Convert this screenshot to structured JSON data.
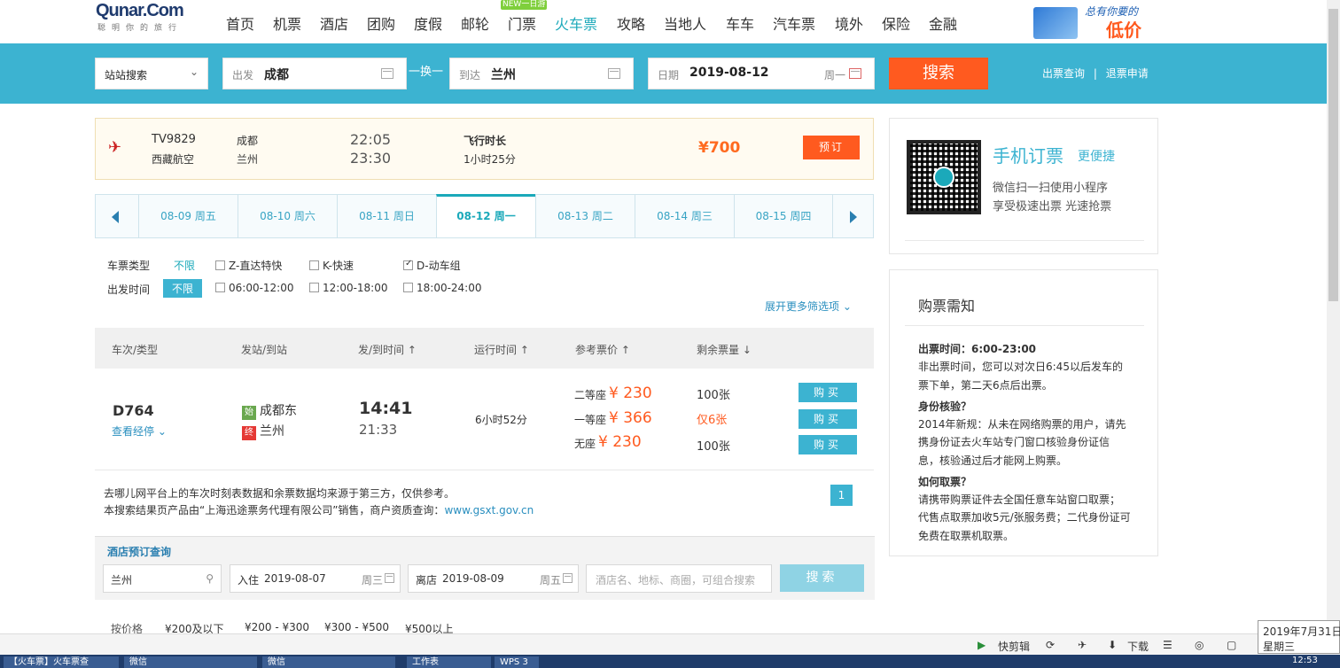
{
  "header": {
    "brand": "Qunar.Com",
    "slogan": "聪明你的旅行",
    "nav": [
      "首页",
      "机票",
      "酒店",
      "团购",
      "度假",
      "邮轮",
      "门票",
      "火车票",
      "攻略",
      "当地人",
      "车车",
      "汽车票",
      "境外",
      "保险",
      "金融"
    ],
    "new_badge": "NEW一日游",
    "promo_line1": "总有你要的",
    "promo_line2": "低价"
  },
  "search": {
    "mode": "站站搜索",
    "from_label": "出发",
    "from_value": "成都",
    "swap_label": "一换一",
    "to_label": "到达",
    "to_value": "兰州",
    "date_label": "日期",
    "date_value": "2019-08-12",
    "weekday": "周一",
    "button": "搜索",
    "link_query": "出票查询",
    "link_refund": "退票申请"
  },
  "flight": {
    "number": "TV9829",
    "airline": "西藏航空",
    "from": "成都",
    "to": "兰州",
    "dep": "22:05",
    "arr": "23:30",
    "dur_label": "飞行时长",
    "dur": "1小时25分",
    "price": "¥700",
    "book": "预订"
  },
  "dates": [
    "08-09 周五",
    "08-10 周六",
    "08-11 周日",
    "08-12 周一",
    "08-13 周二",
    "08-14 周三",
    "08-15 周四"
  ],
  "filters": {
    "type_label": "车票类型",
    "time_label": "出发时间",
    "unlimited": "不限",
    "types": [
      "Z-直达特快",
      "K-快速",
      "D-动车组"
    ],
    "times": [
      "06:00-12:00",
      "12:00-18:00",
      "18:00-24:00"
    ],
    "expand": "展开更多筛选项"
  },
  "results_header": [
    "车次/类型",
    "发站/到站",
    "发/到时间",
    "运行时间",
    "参考票价",
    "剩余票量"
  ],
  "train": {
    "code": "D764",
    "stops_link": "查看经停",
    "start_tag": "始",
    "end_tag": "终",
    "from_station": "成都东",
    "to_station": "兰州",
    "dep": "14:41",
    "arr": "21:33",
    "duration": "6小时52分",
    "seats": [
      {
        "name": "二等座",
        "price": "¥ 230",
        "left": "100张",
        "buy": "购买"
      },
      {
        "name": "一等座",
        "price": "¥ 366",
        "left": "仅6张",
        "buy": "购买"
      },
      {
        "name": "无座",
        "price": "¥ 230",
        "left": "100张",
        "buy": "购买"
      }
    ]
  },
  "notes": {
    "line1": "去哪儿网平台上的车次时刻表数据和余票数据均来源于第三方，仅供参考。",
    "line2": "本搜索结果页产品由“上海迅途票务代理有限公司”销售，商户资质查询：",
    "link": "www.gsxt.gov.cn",
    "page": "1"
  },
  "hotel": {
    "title": "酒店预订查询",
    "city": "兰州",
    "checkin_label": "入住",
    "checkin": "2019-08-07",
    "checkin_wd": "周三",
    "checkout_label": "离店",
    "checkout": "2019-08-09",
    "checkout_wd": "周五",
    "placeholder": "酒店名、地标、商圈，可组合搜索",
    "button": "搜索",
    "price_label": "按价格",
    "prices": [
      "¥200及以下",
      "¥200 - ¥300",
      "¥300 - ¥500",
      "¥500以上"
    ]
  },
  "mobile": {
    "title": "手机订票",
    "title2": "更便捷",
    "line1": "微信扫一扫使用小程序",
    "line2": "享受极速出票 光速抢票"
  },
  "notice": {
    "title": "购票需知",
    "lines": [
      {
        "t": "出票时间：6:00-23:00",
        "b": true
      },
      {
        "t": "非出票时间，您可以对次日6:45以后发车的",
        "b": false
      },
      {
        "t": "票下单，第二天6点后出票。",
        "b": false
      },
      {
        "t": "身份核验？",
        "b": true
      },
      {
        "t": "2014年新规：从未在网络购票的用户，请先",
        "b": false
      },
      {
        "t": "携身份证去火车站专门窗口核验身份证信",
        "b": false
      },
      {
        "t": "息，核验通过后才能网上购票。",
        "b": false
      },
      {
        "t": "如何取票？",
        "b": true
      },
      {
        "t": "请携带购票证件去全国任意车站窗口取票；",
        "b": false
      },
      {
        "t": "代售点取票加收5元/张服务费；二代身份证可",
        "b": false
      },
      {
        "t": "免费在取票机取票。",
        "b": false
      }
    ]
  },
  "statusbar": {
    "quick_edit": "快剪辑",
    "download": "下载"
  },
  "clock": {
    "date": "2019年7月31日",
    "weekday": "星期三",
    "time": "12:53"
  },
  "taskbar": [
    "【火车票】火车票查",
    "微信",
    "微信",
    "工作表",
    "WPS 3"
  ]
}
